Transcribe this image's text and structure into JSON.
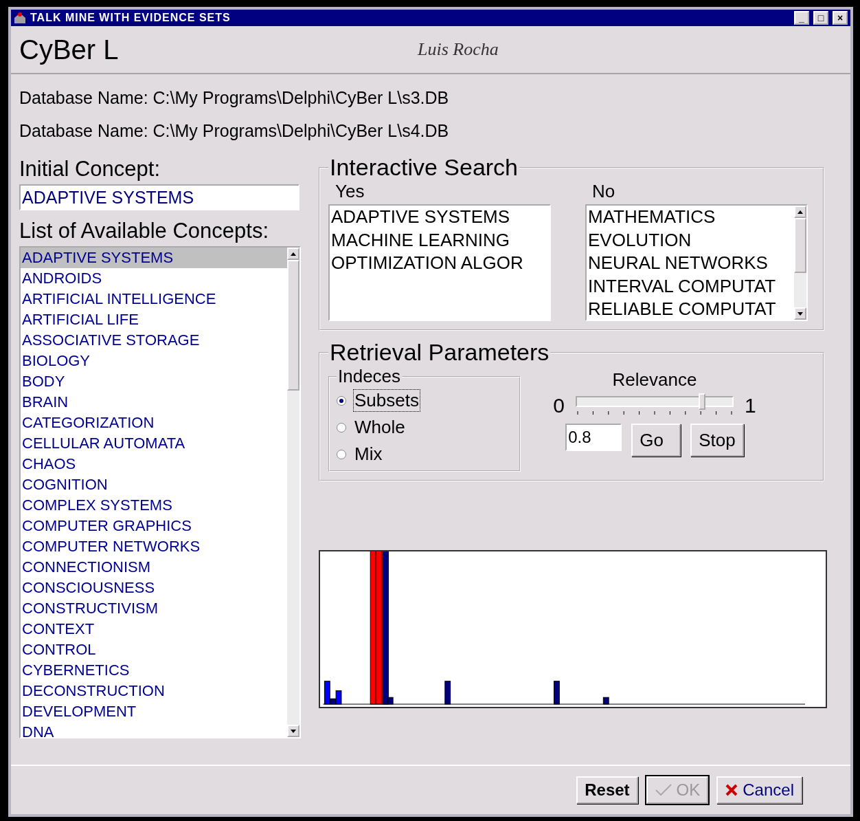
{
  "window": {
    "title": "TALK MINE WITH EVIDENCE SETS",
    "controls": [
      "_",
      "□",
      "×"
    ]
  },
  "header": {
    "app_name": "CyBer L",
    "author": "Luis Rocha"
  },
  "databases": [
    "Database Name: C:\\My Programs\\Delphi\\CyBer L\\s3.DB",
    "Database Name: C:\\My Programs\\Delphi\\CyBer L\\s4.DB"
  ],
  "initial_concept": {
    "label": "Initial Concept:",
    "value": "ADAPTIVE SYSTEMS"
  },
  "concepts": {
    "label": "List of Available Concepts:",
    "items": [
      {
        "label": "ADAPTIVE SYSTEMS",
        "selected": true
      },
      {
        "label": "ANDROIDS",
        "selected": false
      },
      {
        "label": "ARTIFICIAL INTELLIGENCE",
        "selected": false
      },
      {
        "label": "ARTIFICIAL LIFE",
        "selected": false
      },
      {
        "label": "ASSOCIATIVE STORAGE",
        "selected": false
      },
      {
        "label": "BIOLOGY",
        "selected": false
      },
      {
        "label": "BODY",
        "selected": false
      },
      {
        "label": "BRAIN",
        "selected": false
      },
      {
        "label": "CATEGORIZATION",
        "selected": false
      },
      {
        "label": "CELLULAR AUTOMATA",
        "selected": false
      },
      {
        "label": "CHAOS",
        "selected": false
      },
      {
        "label": "COGNITION",
        "selected": false
      },
      {
        "label": "COMPLEX SYSTEMS",
        "selected": false
      },
      {
        "label": "COMPUTER GRAPHICS",
        "selected": false
      },
      {
        "label": "COMPUTER NETWORKS",
        "selected": false
      },
      {
        "label": "CONNECTIONISM",
        "selected": false
      },
      {
        "label": "CONSCIOUSNESS",
        "selected": false
      },
      {
        "label": "CONSTRUCTIVISM",
        "selected": false
      },
      {
        "label": "CONTEXT",
        "selected": false
      },
      {
        "label": "CONTROL",
        "selected": false
      },
      {
        "label": "CYBERNETICS",
        "selected": false
      },
      {
        "label": "DECONSTRUCTION",
        "selected": false
      },
      {
        "label": "DEVELOPMENT",
        "selected": false
      },
      {
        "label": "DNA",
        "selected": false
      }
    ]
  },
  "interactive_search": {
    "title": "Interactive Search",
    "yes": {
      "label": "Yes",
      "items": [
        "ADAPTIVE SYSTEMS",
        "MACHINE LEARNING",
        "OPTIMIZATION ALGOR"
      ]
    },
    "no": {
      "label": "No",
      "items": [
        "MATHEMATICS",
        "EVOLUTION",
        "NEURAL NETWORKS",
        "INTERVAL COMPUTAT",
        "RELIABLE COMPUTAT"
      ]
    }
  },
  "retrieval": {
    "title": "Retrieval Parameters",
    "indices": {
      "title": "Indeces",
      "options": [
        {
          "label": "Subsets",
          "selected": true
        },
        {
          "label": "Whole",
          "selected": false
        },
        {
          "label": "Mix",
          "selected": false
        }
      ]
    },
    "relevance": {
      "label": "Relevance",
      "min": "0",
      "max": "1",
      "level": 0.8,
      "value": "0.8"
    },
    "buttons": [
      "Go",
      "Stop"
    ]
  },
  "footer_buttons": [
    {
      "label": "Reset",
      "kind": "plain",
      "disabled": false
    },
    {
      "label": "OK",
      "kind": "ok",
      "disabled": true
    },
    {
      "label": "Cancel",
      "kind": "cancel",
      "disabled": false
    }
  ]
}
